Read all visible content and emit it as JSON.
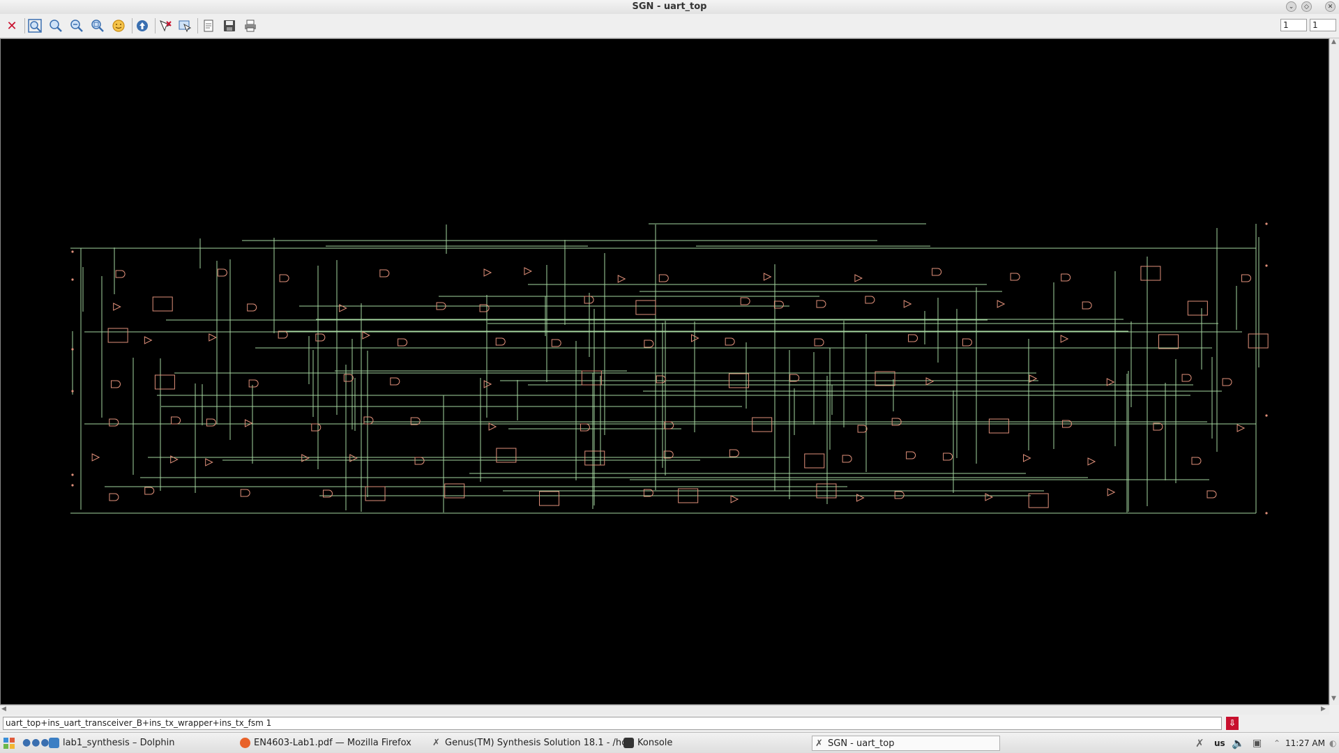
{
  "window": {
    "title": "SGN - uart_top"
  },
  "toolbar": {
    "buttons": [
      {
        "icon": "close-red-x-icon",
        "label": "Close"
      },
      {
        "icon": "zoom-fit-icon",
        "label": "Zoom fit"
      },
      {
        "icon": "zoom-in-icon",
        "label": "Zoom in"
      },
      {
        "icon": "zoom-out-icon",
        "label": "Zoom out"
      },
      {
        "icon": "zoom-area-icon",
        "label": "Zoom area"
      },
      {
        "icon": "smiley-icon",
        "label": "Face"
      },
      {
        "icon": "up-hierarchy-icon",
        "label": "Up"
      },
      {
        "icon": "select-tool-icon",
        "label": "Select"
      },
      {
        "icon": "deselect-tool-icon",
        "label": "Deselect"
      },
      {
        "icon": "document-icon",
        "label": "Document"
      },
      {
        "icon": "save-icon",
        "label": "Save"
      },
      {
        "icon": "print-icon",
        "label": "Print"
      }
    ],
    "page_fields": [
      "1",
      "1"
    ]
  },
  "status": {
    "path": "uart_top+ins_uart_transceiver_B+ins_tx_wrapper+ins_tx_fsm 1",
    "download_icon": "download-arrow-icon"
  },
  "taskbar": {
    "apps": [
      {
        "label": "lab1_synthesis – Dolphin",
        "icon": "folder-icon",
        "color": "#3c7fc4"
      },
      {
        "label": "EN4603-Lab1.pdf — Mozilla Firefox",
        "icon": "firefox-icon",
        "color": "#e8622a"
      },
      {
        "label": "Genus(TM) Synthesis Solution 18.1 - /hc",
        "icon": "x-app-icon",
        "color": "#555555"
      },
      {
        "label": "Konsole",
        "icon": "terminal-icon",
        "color": "#333333"
      },
      {
        "label": "SGN - uart_top",
        "icon": "x-app-icon",
        "color": "#555555"
      }
    ],
    "tray": {
      "keyboard_layout": "us",
      "clock": "11:27 AM"
    }
  },
  "colors": {
    "wire": "#a5d6a0",
    "cell": "#e0907a",
    "canvas": "#000000"
  }
}
